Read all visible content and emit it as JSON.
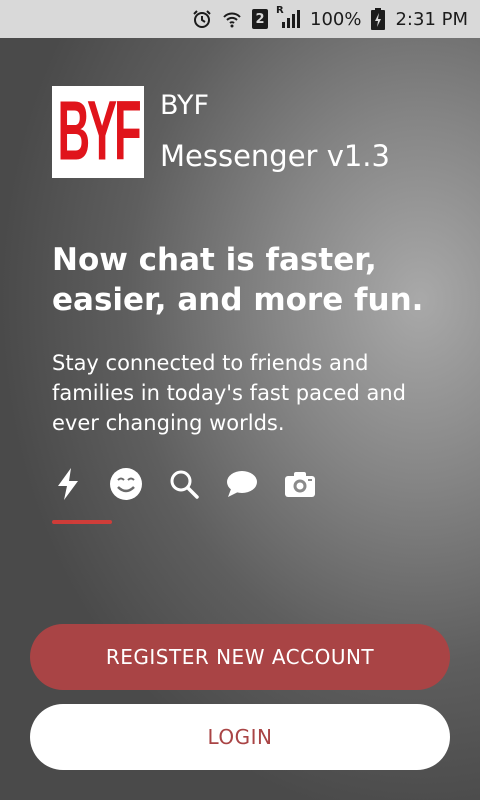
{
  "status_bar": {
    "sim_slot": "2",
    "roaming": "R",
    "battery": "100%",
    "time": "2:31 PM"
  },
  "brand": {
    "logo_text": "BYF",
    "name": "BYF",
    "version": "Messenger v1.3"
  },
  "headline": "Now chat is faster, easier, and more fun.",
  "subtext": "Stay connected to friends and families in today's fast paced and ever changing worlds.",
  "features": [
    {
      "icon": "lightning-icon"
    },
    {
      "icon": "smiley-icon"
    },
    {
      "icon": "search-icon"
    },
    {
      "icon": "chat-bubble-icon"
    },
    {
      "icon": "camera-icon"
    }
  ],
  "buttons": {
    "register": "REGISTER NEW ACCOUNT",
    "login": "LOGIN"
  },
  "colors": {
    "accent": "#a94445",
    "indicator": "#e53935",
    "logo_red": "#e0141b"
  }
}
